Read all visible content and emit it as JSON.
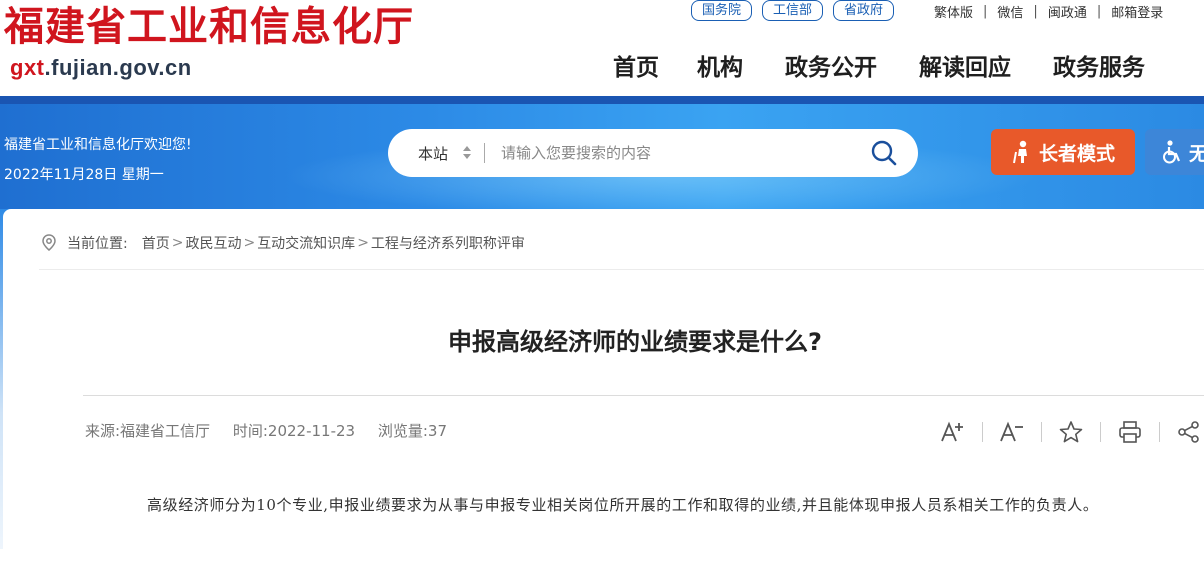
{
  "header": {
    "site_title": "福建省工业和信息化厅",
    "domain_prefix": "gxt",
    "domain_rest": ".fujian.gov.cn",
    "top_links": [
      "国务院",
      "工信部",
      "省政府"
    ],
    "util_links": [
      "繁体版",
      "微信",
      "闽政通",
      "邮箱登录"
    ],
    "nav": [
      "首页",
      "机构",
      "政务公开",
      "解读回应",
      "政务服务"
    ]
  },
  "banner": {
    "welcome": "福建省工业和信息化厅欢迎您!",
    "date": "2022年11月28日 星期一",
    "search_scope": "本站",
    "search_placeholder": "请输入您要搜索的内容",
    "elder_mode": "长者模式",
    "accessibility": "无"
  },
  "breadcrumb": {
    "label": "当前位置:",
    "items": [
      "首页",
      "政民互动",
      "互动交流知识库",
      "工程与经济系列职称评审"
    ]
  },
  "article": {
    "title": "申报高级经济师的业绩要求是什么?",
    "source": "来源:福建省工信厅",
    "time": "时间:2022-11-23",
    "views": "浏览量:37",
    "body": "高级经济师分为10个专业,申报业绩要求为从事与申报专业相关岗位所开展的工作和取得的业绩,并且能体现申报人员系相关工作的负责人。"
  },
  "colors": {
    "brand_red": "#d0151e",
    "link_blue": "#1a5fb4",
    "elder_orange": "#e8592a"
  }
}
